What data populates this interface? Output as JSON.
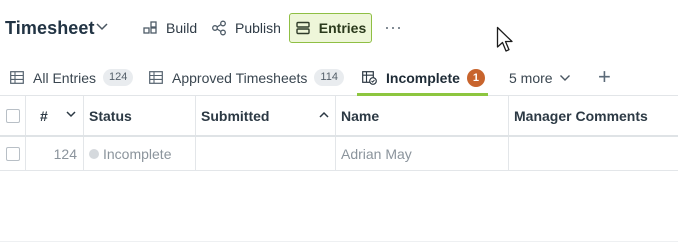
{
  "app": {
    "title": "Timesheet"
  },
  "toolbar": {
    "build_label": "Build",
    "publish_label": "Publish",
    "entries_label": "Entries",
    "more_label": "···"
  },
  "tabs": {
    "all_entries": {
      "label": "All Entries",
      "count": "124"
    },
    "approved": {
      "label": "Approved Timesheets",
      "count": "114"
    },
    "incomplete": {
      "label": "Incomplete",
      "count": "1"
    },
    "more": {
      "label": "5 more"
    },
    "add_label": "+"
  },
  "table": {
    "headers": {
      "number": "#",
      "status": "Status",
      "submitted": "Submitted",
      "name": "Name",
      "manager_comments": "Manager Comments"
    },
    "rows": [
      {
        "number": "124",
        "status": "Incomplete",
        "submitted": "",
        "name": "Adrian May",
        "manager_comments": ""
      }
    ]
  },
  "colors": {
    "accent_green": "#8dc63f",
    "alert_badge": "#c8642d",
    "active_button_bg": "#eef6d9"
  }
}
